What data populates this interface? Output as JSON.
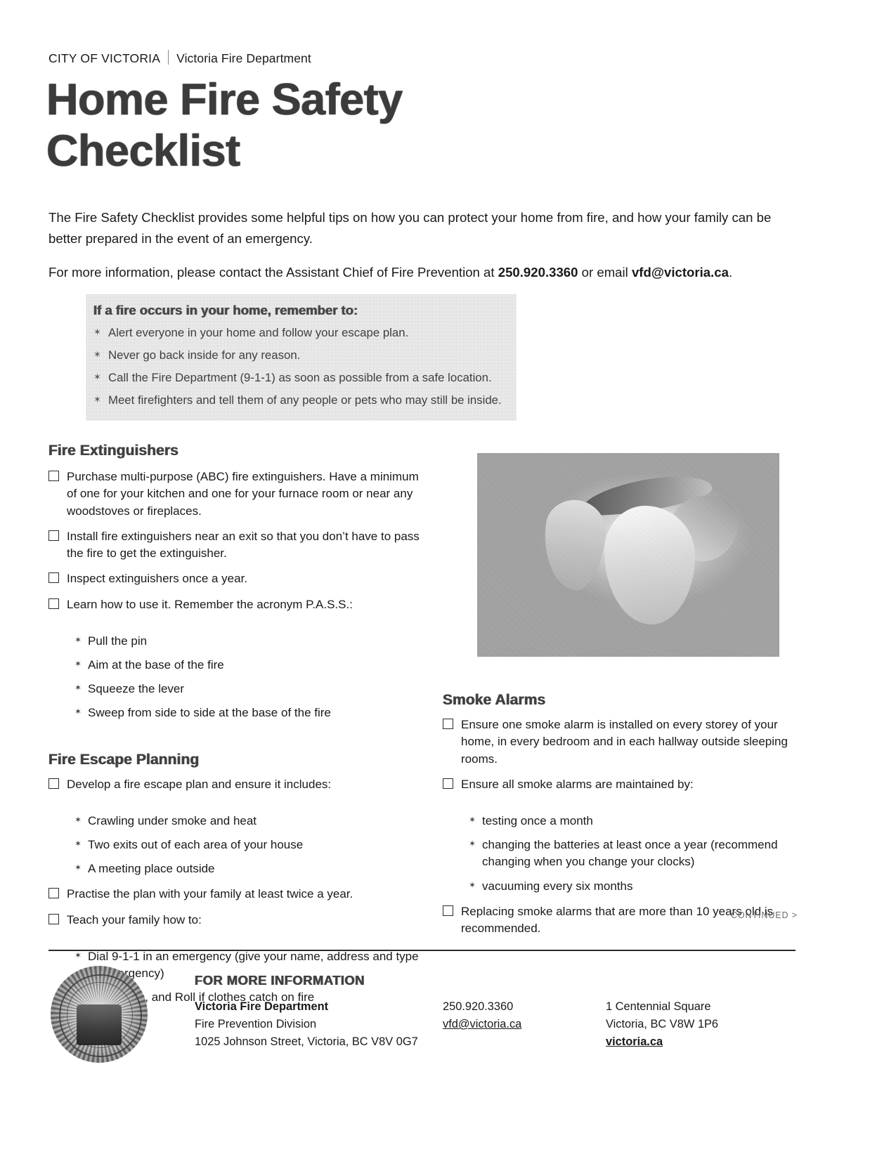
{
  "masthead": {
    "city": "CITY OF VICTORIA",
    "department": "Victoria Fire Department"
  },
  "title": {
    "line1": "Home Fire Safety",
    "line2": "Checklist"
  },
  "intro": {
    "paragraph1": "The Fire Safety Checklist provides some helpful tips on how you can protect your home from fire, and how your family can be better prepared in the event of an emergency.",
    "contact_prefix": "For more information, please contact the Assistant Chief of Fire Prevention at ",
    "contact_phone": "250.920.3360",
    "contact_middle": " or email ",
    "contact_email": "vfd@victoria.ca",
    "contact_suffix": "."
  },
  "callout": {
    "title": "If a fire occurs in your home, remember to:",
    "bullet_glyph": "✶",
    "items": [
      "Alert everyone in your home and follow your escape plan.",
      "Never go back inside for any reason.",
      "Call the Fire Department (9-1-1) as soon as possible from a safe location.",
      "Meet firefighters and tell them of any people or pets who may still be inside."
    ]
  },
  "bullet_glyph": "✶",
  "fire_extinguishers": {
    "heading": "Fire Extinguishers",
    "items": [
      "Purchase multi-purpose (ABC) fire extinguishers. Have a minimum of one for your kitchen and one for your furnace room or near any woodstoves or fireplaces.",
      "Install fire extinguishers near an exit so that you don’t have to pass the fire to get the extinguisher.",
      "Inspect extinguishers once a year.",
      "Learn how to use it. Remember the acronym P.A.S.S.:"
    ],
    "pass_steps": [
      "Pull the pin",
      "Aim at the base of the fire",
      "Squeeze the lever",
      "Sweep from side to side at the base of the fire"
    ]
  },
  "fire_escape": {
    "heading": "Fire Escape Planning",
    "item_develop": "Develop a fire escape plan and ensure it includes:",
    "develop_subs": [
      "Crawling under smoke and heat",
      "Two exits out of each area of your house",
      "A meeting place outside"
    ],
    "item_practise": "Practise the plan with your family at least twice a year.",
    "item_teach": "Teach your family how to:",
    "teach_subs": [
      "Dial 9-1-1 in an emergency (give your name, address and type of emergency)",
      "Stop, Drop, and Roll if clothes catch on fire"
    ]
  },
  "smoke_alarms": {
    "heading": "Smoke Alarms",
    "item_install": "Ensure one smoke alarm is installed on every storey of your home, in every bedroom and in each hallway outside sleeping rooms.",
    "item_maintain": "Ensure all smoke alarms are maintained by:",
    "maintain_subs": [
      "testing once a month",
      "changing the batteries at least once a year (recommend changing when you change your clocks)",
      "vacuuming every six months"
    ],
    "item_replace": "Replacing smoke alarms that are more than 10 years old is recommended."
  },
  "continued": "CONTINUED >",
  "footer": {
    "heading": "FOR MORE INFORMATION",
    "col1": {
      "line1": "Victoria Fire Department",
      "line2": "Fire Prevention Division",
      "line3": "1025 Johnson Street, Victoria, BC V8V 0G7"
    },
    "col2": {
      "phone": "250.920.3360",
      "email": "vfd@victoria.ca"
    },
    "col3": {
      "line1": "1 Centennial Square",
      "line2": "Victoria, BC V8W 1P6",
      "website": "victoria.ca"
    }
  }
}
